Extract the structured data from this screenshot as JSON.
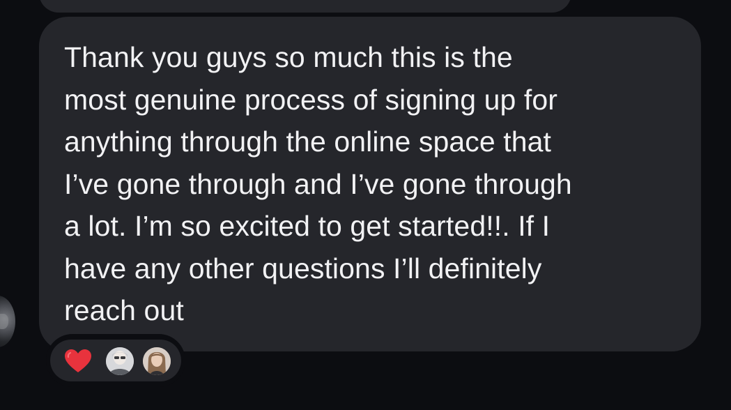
{
  "message": {
    "text": "Thank you guys so much this is the\nmost genuine process of signing up for\nanything through the online space that\nI’ve gone through and I’ve gone through\na lot. I’m so excited to get started!!. If I\nhave any other questions I’ll definitely\nreach out"
  },
  "reactions": {
    "emoji_icon": "heart-icon",
    "reactors": [
      {
        "avatar": "avatar-photo"
      },
      {
        "avatar": "avatar-photo"
      }
    ]
  },
  "colors": {
    "background": "#0c0d11",
    "bubble": "#25262b",
    "text": "#f2f2f4",
    "heart": "#e8333d"
  }
}
